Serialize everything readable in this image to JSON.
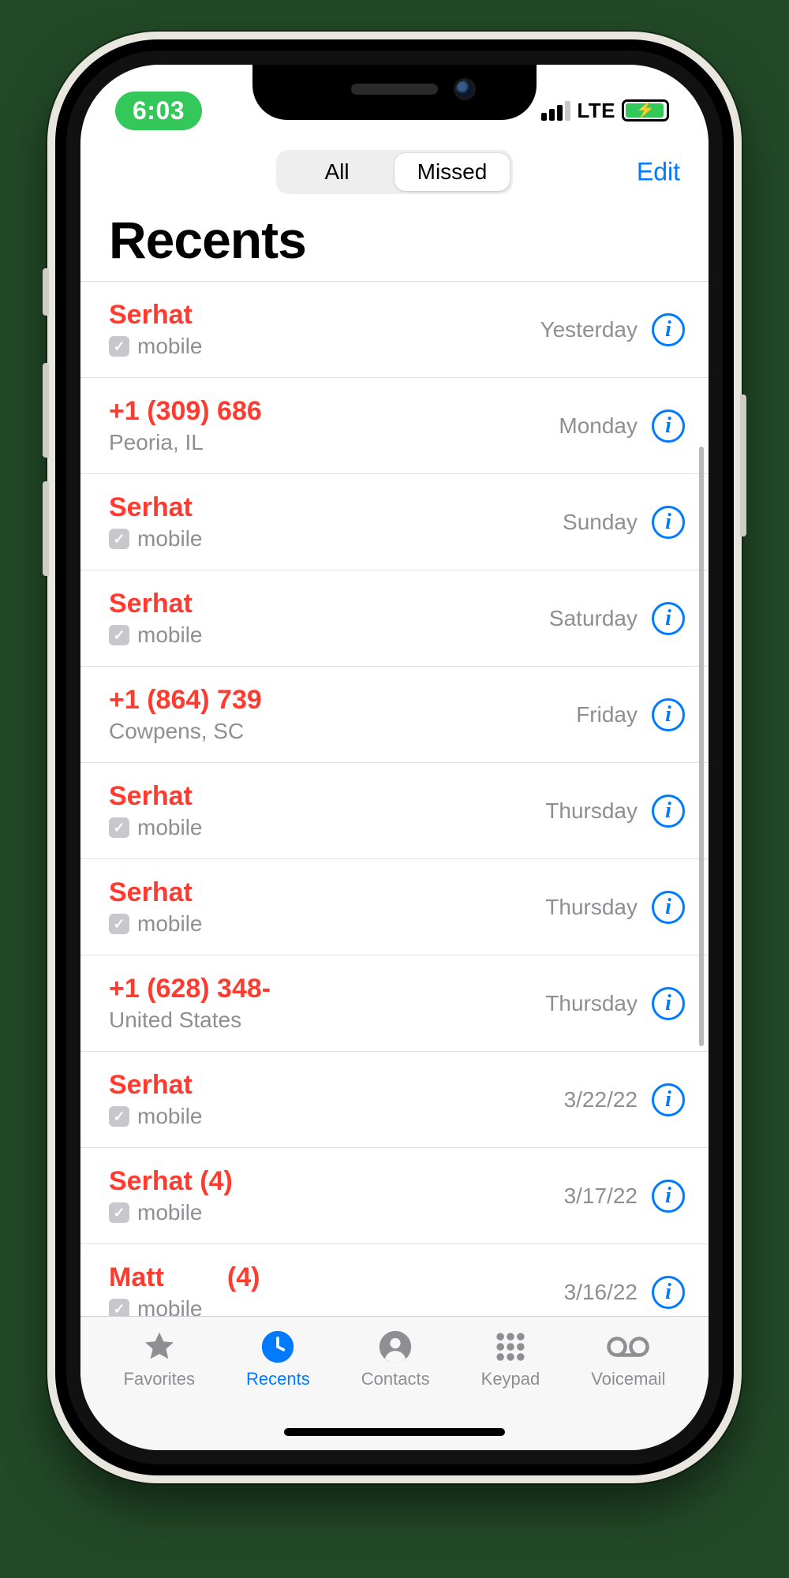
{
  "status": {
    "time": "6:03",
    "network": "LTE"
  },
  "nav": {
    "seg_all": "All",
    "seg_missed": "Missed",
    "edit": "Edit"
  },
  "title": "Recents",
  "calls": [
    {
      "name": "Serhat",
      "sub": "mobile",
      "badge": true,
      "time": "Yesterday"
    },
    {
      "name": "+1 (309) 686",
      "sub": "Peoria, IL",
      "badge": false,
      "time": "Monday"
    },
    {
      "name": "Serhat",
      "sub": "mobile",
      "badge": true,
      "time": "Sunday"
    },
    {
      "name": "Serhat",
      "sub": "mobile",
      "badge": true,
      "time": "Saturday"
    },
    {
      "name": "+1 (864) 739",
      "sub": "Cowpens, SC",
      "badge": false,
      "time": "Friday"
    },
    {
      "name": "Serhat",
      "sub": "mobile",
      "badge": true,
      "time": "Thursday"
    },
    {
      "name": "Serhat",
      "sub": "mobile",
      "badge": true,
      "time": "Thursday"
    },
    {
      "name": "+1 (628) 348-",
      "sub": "United States",
      "badge": false,
      "time": "Thursday"
    },
    {
      "name": "Serhat",
      "sub": "mobile",
      "badge": true,
      "time": "3/22/22"
    },
    {
      "name": "Serhat (4)",
      "sub": "mobile",
      "badge": true,
      "time": "3/17/22"
    },
    {
      "name": "Matt",
      "count": "(4)",
      "sub": "mobile",
      "badge": true,
      "time": "3/16/22"
    }
  ],
  "tabs": {
    "favorites": "Favorites",
    "recents": "Recents",
    "contacts": "Contacts",
    "keypad": "Keypad",
    "voicemail": "Voicemail"
  }
}
